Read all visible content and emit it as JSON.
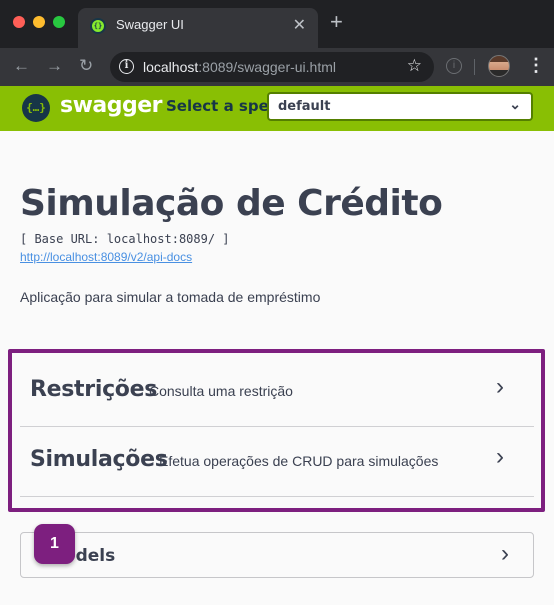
{
  "browser": {
    "tab_title": "Swagger UI",
    "tab_close": "✕",
    "new_tab": "+",
    "url_host": "localhost",
    "url_rest": ":8089/swagger-ui.html"
  },
  "swagger": {
    "logo_text": "swagger",
    "spec_label": "Select a spec",
    "spec_value": "default"
  },
  "info": {
    "title": "Simulação de Crédito",
    "base_url": "[ Base URL: localhost:8089/ ]",
    "docs_link": "http://localhost:8089/v2/api-docs",
    "description": "Aplicação para simular a tomada de empréstimo"
  },
  "tags": [
    {
      "name": "Restrições",
      "description": "Consulta uma restrição"
    },
    {
      "name": "Simulações",
      "description": "Efetua operações de CRUD para simulações"
    }
  ],
  "models": {
    "title": "Models"
  },
  "badge": {
    "label": "1"
  },
  "colors": {
    "swagger_green": "#89bf04",
    "highlight": "#7d1f7f",
    "text": "#3b4151",
    "link": "#4990e2"
  },
  "icons": [
    "back-icon",
    "forward-icon",
    "reload-icon",
    "info-icon",
    "star-icon",
    "extension-icon",
    "avatar",
    "menu-icon",
    "chevron-down-icon",
    "chevron-right-icon"
  ]
}
